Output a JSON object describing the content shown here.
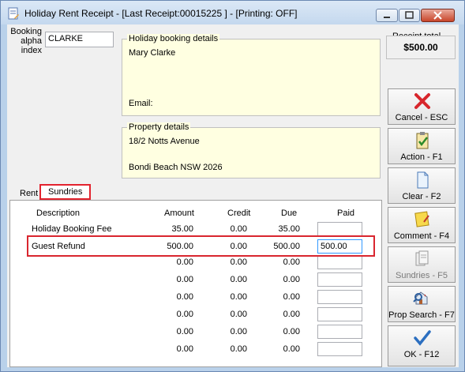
{
  "window": {
    "title": "Holiday Rent Receipt - [Last Receipt:00015225 ] - [Printing: OFF]"
  },
  "booking": {
    "label_line1": "Booking",
    "label_line2": "alpha",
    "label_line3": "index",
    "value": "CLARKE"
  },
  "holiday_booking": {
    "legend": "Holiday booking details",
    "name": "Mary Clarke",
    "email_label": "Email:"
  },
  "property": {
    "legend": "Property details",
    "address1": "18/2 Notts Avenue",
    "address2": "Bondi Beach  NSW  2026"
  },
  "receipt_total": {
    "label": "Receipt total",
    "value": "$500.00"
  },
  "side_buttons": [
    {
      "label": "Cancel - ESC",
      "icon": "red-x-icon"
    },
    {
      "label": "Action - F1",
      "icon": "clipboard-check-icon"
    },
    {
      "label": "Clear - F2",
      "icon": "blank-page-icon"
    },
    {
      "label": "Comment - F4",
      "icon": "comment-note-icon"
    },
    {
      "label": "Sundries - F5",
      "icon": "documents-icon"
    },
    {
      "label": "Prop Search - F7",
      "icon": "house-search-icon"
    },
    {
      "label": "OK - F12",
      "icon": "checkmark-icon"
    }
  ],
  "tabs": {
    "rent": "Rent",
    "sundries": "Sundries"
  },
  "table": {
    "headers": {
      "description": "Description",
      "amount": "Amount",
      "credit": "Credit",
      "due": "Due",
      "paid": "Paid"
    },
    "rows": [
      {
        "description": "Holiday Booking Fee",
        "amount": "35.00",
        "credit": "0.00",
        "due": "35.00",
        "paid": ""
      },
      {
        "description": "Guest Refund",
        "amount": "500.00",
        "credit": "0.00",
        "due": "500.00",
        "paid": "500.00"
      },
      {
        "description": "",
        "amount": "0.00",
        "credit": "0.00",
        "due": "0.00",
        "paid": ""
      },
      {
        "description": "",
        "amount": "0.00",
        "credit": "0.00",
        "due": "0.00",
        "paid": ""
      },
      {
        "description": "",
        "amount": "0.00",
        "credit": "0.00",
        "due": "0.00",
        "paid": ""
      },
      {
        "description": "",
        "amount": "0.00",
        "credit": "0.00",
        "due": "0.00",
        "paid": ""
      },
      {
        "description": "",
        "amount": "0.00",
        "credit": "0.00",
        "due": "0.00",
        "paid": ""
      },
      {
        "description": "",
        "amount": "0.00",
        "credit": "0.00",
        "due": "0.00",
        "paid": ""
      }
    ]
  }
}
